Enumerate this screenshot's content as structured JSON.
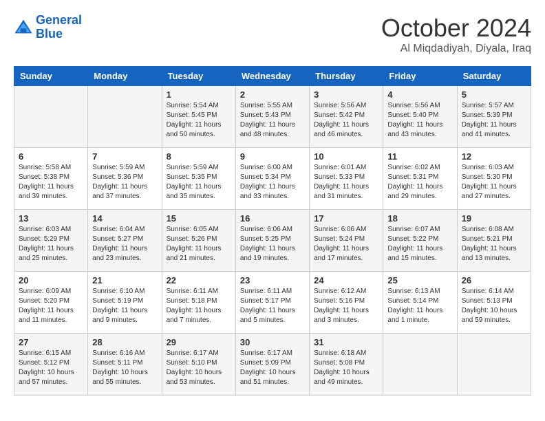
{
  "logo": {
    "line1": "General",
    "line2": "Blue"
  },
  "title": "October 2024",
  "subtitle": "Al Miqdadiyah, Diyala, Iraq",
  "headers": [
    "Sunday",
    "Monday",
    "Tuesday",
    "Wednesday",
    "Thursday",
    "Friday",
    "Saturday"
  ],
  "weeks": [
    [
      {
        "day": "",
        "sunrise": "",
        "sunset": "",
        "daylight": ""
      },
      {
        "day": "",
        "sunrise": "",
        "sunset": "",
        "daylight": ""
      },
      {
        "day": "1",
        "sunrise": "Sunrise: 5:54 AM",
        "sunset": "Sunset: 5:45 PM",
        "daylight": "Daylight: 11 hours and 50 minutes."
      },
      {
        "day": "2",
        "sunrise": "Sunrise: 5:55 AM",
        "sunset": "Sunset: 5:43 PM",
        "daylight": "Daylight: 11 hours and 48 minutes."
      },
      {
        "day": "3",
        "sunrise": "Sunrise: 5:56 AM",
        "sunset": "Sunset: 5:42 PM",
        "daylight": "Daylight: 11 hours and 46 minutes."
      },
      {
        "day": "4",
        "sunrise": "Sunrise: 5:56 AM",
        "sunset": "Sunset: 5:40 PM",
        "daylight": "Daylight: 11 hours and 43 minutes."
      },
      {
        "day": "5",
        "sunrise": "Sunrise: 5:57 AM",
        "sunset": "Sunset: 5:39 PM",
        "daylight": "Daylight: 11 hours and 41 minutes."
      }
    ],
    [
      {
        "day": "6",
        "sunrise": "Sunrise: 5:58 AM",
        "sunset": "Sunset: 5:38 PM",
        "daylight": "Daylight: 11 hours and 39 minutes."
      },
      {
        "day": "7",
        "sunrise": "Sunrise: 5:59 AM",
        "sunset": "Sunset: 5:36 PM",
        "daylight": "Daylight: 11 hours and 37 minutes."
      },
      {
        "day": "8",
        "sunrise": "Sunrise: 5:59 AM",
        "sunset": "Sunset: 5:35 PM",
        "daylight": "Daylight: 11 hours and 35 minutes."
      },
      {
        "day": "9",
        "sunrise": "Sunrise: 6:00 AM",
        "sunset": "Sunset: 5:34 PM",
        "daylight": "Daylight: 11 hours and 33 minutes."
      },
      {
        "day": "10",
        "sunrise": "Sunrise: 6:01 AM",
        "sunset": "Sunset: 5:33 PM",
        "daylight": "Daylight: 11 hours and 31 minutes."
      },
      {
        "day": "11",
        "sunrise": "Sunrise: 6:02 AM",
        "sunset": "Sunset: 5:31 PM",
        "daylight": "Daylight: 11 hours and 29 minutes."
      },
      {
        "day": "12",
        "sunrise": "Sunrise: 6:03 AM",
        "sunset": "Sunset: 5:30 PM",
        "daylight": "Daylight: 11 hours and 27 minutes."
      }
    ],
    [
      {
        "day": "13",
        "sunrise": "Sunrise: 6:03 AM",
        "sunset": "Sunset: 5:29 PM",
        "daylight": "Daylight: 11 hours and 25 minutes."
      },
      {
        "day": "14",
        "sunrise": "Sunrise: 6:04 AM",
        "sunset": "Sunset: 5:27 PM",
        "daylight": "Daylight: 11 hours and 23 minutes."
      },
      {
        "day": "15",
        "sunrise": "Sunrise: 6:05 AM",
        "sunset": "Sunset: 5:26 PM",
        "daylight": "Daylight: 11 hours and 21 minutes."
      },
      {
        "day": "16",
        "sunrise": "Sunrise: 6:06 AM",
        "sunset": "Sunset: 5:25 PM",
        "daylight": "Daylight: 11 hours and 19 minutes."
      },
      {
        "day": "17",
        "sunrise": "Sunrise: 6:06 AM",
        "sunset": "Sunset: 5:24 PM",
        "daylight": "Daylight: 11 hours and 17 minutes."
      },
      {
        "day": "18",
        "sunrise": "Sunrise: 6:07 AM",
        "sunset": "Sunset: 5:22 PM",
        "daylight": "Daylight: 11 hours and 15 minutes."
      },
      {
        "day": "19",
        "sunrise": "Sunrise: 6:08 AM",
        "sunset": "Sunset: 5:21 PM",
        "daylight": "Daylight: 11 hours and 13 minutes."
      }
    ],
    [
      {
        "day": "20",
        "sunrise": "Sunrise: 6:09 AM",
        "sunset": "Sunset: 5:20 PM",
        "daylight": "Daylight: 11 hours and 11 minutes."
      },
      {
        "day": "21",
        "sunrise": "Sunrise: 6:10 AM",
        "sunset": "Sunset: 5:19 PM",
        "daylight": "Daylight: 11 hours and 9 minutes."
      },
      {
        "day": "22",
        "sunrise": "Sunrise: 6:11 AM",
        "sunset": "Sunset: 5:18 PM",
        "daylight": "Daylight: 11 hours and 7 minutes."
      },
      {
        "day": "23",
        "sunrise": "Sunrise: 6:11 AM",
        "sunset": "Sunset: 5:17 PM",
        "daylight": "Daylight: 11 hours and 5 minutes."
      },
      {
        "day": "24",
        "sunrise": "Sunrise: 6:12 AM",
        "sunset": "Sunset: 5:16 PM",
        "daylight": "Daylight: 11 hours and 3 minutes."
      },
      {
        "day": "25",
        "sunrise": "Sunrise: 6:13 AM",
        "sunset": "Sunset: 5:14 PM",
        "daylight": "Daylight: 11 hours and 1 minute."
      },
      {
        "day": "26",
        "sunrise": "Sunrise: 6:14 AM",
        "sunset": "Sunset: 5:13 PM",
        "daylight": "Daylight: 10 hours and 59 minutes."
      }
    ],
    [
      {
        "day": "27",
        "sunrise": "Sunrise: 6:15 AM",
        "sunset": "Sunset: 5:12 PM",
        "daylight": "Daylight: 10 hours and 57 minutes."
      },
      {
        "day": "28",
        "sunrise": "Sunrise: 6:16 AM",
        "sunset": "Sunset: 5:11 PM",
        "daylight": "Daylight: 10 hours and 55 minutes."
      },
      {
        "day": "29",
        "sunrise": "Sunrise: 6:17 AM",
        "sunset": "Sunset: 5:10 PM",
        "daylight": "Daylight: 10 hours and 53 minutes."
      },
      {
        "day": "30",
        "sunrise": "Sunrise: 6:17 AM",
        "sunset": "Sunset: 5:09 PM",
        "daylight": "Daylight: 10 hours and 51 minutes."
      },
      {
        "day": "31",
        "sunrise": "Sunrise: 6:18 AM",
        "sunset": "Sunset: 5:08 PM",
        "daylight": "Daylight: 10 hours and 49 minutes."
      },
      {
        "day": "",
        "sunrise": "",
        "sunset": "",
        "daylight": ""
      },
      {
        "day": "",
        "sunrise": "",
        "sunset": "",
        "daylight": ""
      }
    ]
  ]
}
